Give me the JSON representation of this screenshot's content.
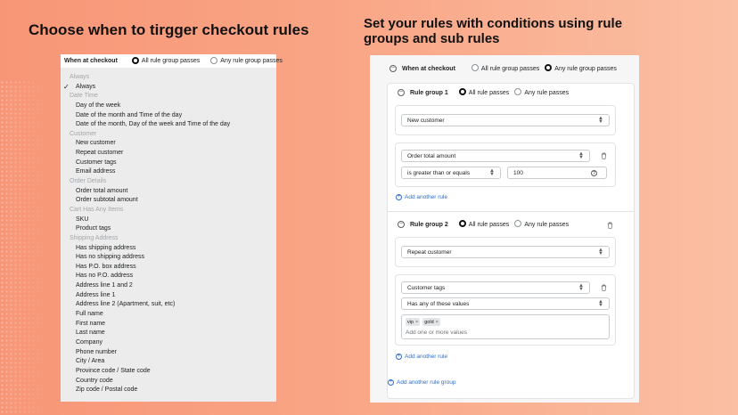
{
  "headings": {
    "left": "Choose when to tirgger checkout rules",
    "right": "Set your rules with conditions using rule groups and sub rules"
  },
  "dropdown_panel": {
    "header_label": "When at checkout",
    "options": [
      "All rule group passes",
      "Any rule group passes"
    ],
    "groups": [
      {
        "label": "Always",
        "items": [
          "Always"
        ]
      },
      {
        "label": "Date Time",
        "items": [
          "Day of the week",
          "Date of the month and Time of the day",
          "Date of the month, Day of the week and Time of the day"
        ]
      },
      {
        "label": "Customer",
        "items": [
          "New customer",
          "Repeat customer",
          "Customer tags",
          "Email address"
        ]
      },
      {
        "label": "Order Details",
        "items": [
          "Order total amount",
          "Order subtotal amount"
        ]
      },
      {
        "label": "Cart Has Any Items",
        "items": [
          "SKU",
          "Product tags"
        ]
      },
      {
        "label": "Shipping Address",
        "items": [
          "Has shipping address",
          "Has no shipping address",
          "Has P.O. box address",
          "Has no P.O. address",
          "Address line 1 and 2",
          "Address line 1",
          "Address line 2 (Apartment, suit, etc)",
          "Full name",
          "First name",
          "Last name",
          "Company",
          "Phone number",
          "City / Area",
          "Province code / State code",
          "Country code",
          "Zip code / Postal code"
        ]
      }
    ]
  },
  "rules_panel": {
    "header_label": "When at checkout",
    "options": [
      "All rule group passes",
      "Any rule group passes"
    ],
    "group1": {
      "title": "Rule group 1",
      "options": [
        "All rule passes",
        "Any rule passes"
      ],
      "condition": "New customer",
      "sub_field": "Order total amount",
      "operator": "is greater than or equals",
      "value": "100",
      "help": "?",
      "add_rule": "Add another rule"
    },
    "group2": {
      "title": "Rule group 2",
      "options": [
        "All rule passes",
        "Any rule passes"
      ],
      "condition": "Repeat customer",
      "sub_field": "Customer tags",
      "operator": "Has any of these values",
      "tags": [
        "vip",
        "gold"
      ],
      "tag_placeholder": "Add one or more values",
      "add_rule": "Add another rule"
    },
    "add_group": "Add another rule group"
  }
}
